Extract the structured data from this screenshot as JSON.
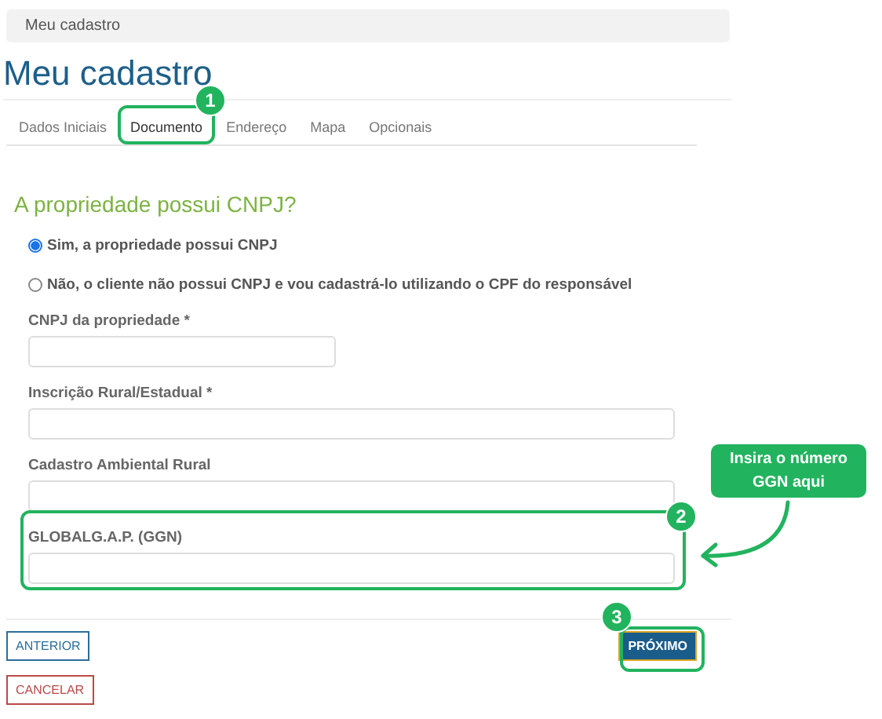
{
  "breadcrumb": "Meu cadastro",
  "title": "Meu cadastro",
  "tabs": [
    {
      "label": "Dados Iniciais",
      "selected": false
    },
    {
      "label": "Documento",
      "selected": true
    },
    {
      "label": "Endereço",
      "selected": false
    },
    {
      "label": "Mapa",
      "selected": false
    },
    {
      "label": "Opcionais",
      "selected": false
    }
  ],
  "question": "A propriedade possui CNPJ?",
  "options": [
    {
      "label": "Sim, a propriedade possui CNPJ",
      "selected": true
    },
    {
      "label": "Não, o cliente não possui CNPJ e vou cadastrá-lo utilizando o CPF do responsável",
      "selected": false
    }
  ],
  "fields": [
    {
      "label": "CNPJ da propriedade *",
      "kind": "short"
    },
    {
      "label": "Inscrição Rural/Estadual *",
      "kind": "full"
    },
    {
      "label": "Cadastro Ambiental Rural",
      "kind": "full"
    },
    {
      "label": "GLOBALG.A.P. (GGN)",
      "kind": "full"
    }
  ],
  "buttons": [
    {
      "label": "ANTERIOR",
      "kind": "secondary"
    },
    {
      "label": "PRÓXIMO",
      "kind": "primary"
    },
    {
      "label": "CANCELAR",
      "kind": "danger"
    }
  ],
  "annotations": {
    "markers": [
      {
        "number": "1"
      },
      {
        "number": "2"
      },
      {
        "number": "3"
      }
    ],
    "callout": "Insira o número GGN aqui"
  }
}
